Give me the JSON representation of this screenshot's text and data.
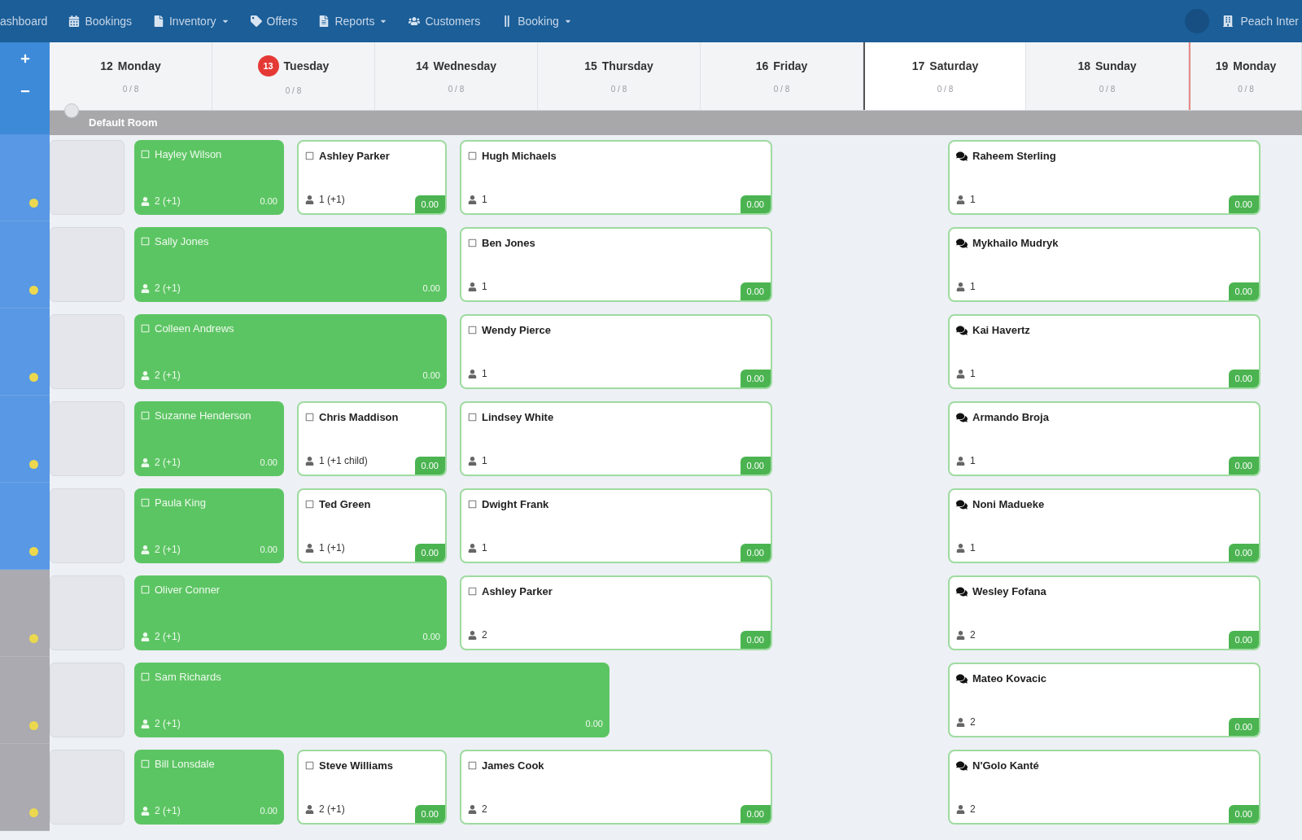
{
  "nav": {
    "items": [
      {
        "label": "ashboard",
        "dropdown": false
      },
      {
        "label": "Bookings",
        "dropdown": false
      },
      {
        "label": "Inventory",
        "dropdown": true
      },
      {
        "label": "Offers",
        "dropdown": false
      },
      {
        "label": "Reports",
        "dropdown": true
      },
      {
        "label": "Customers",
        "dropdown": false
      },
      {
        "label": "Booking",
        "dropdown": true
      }
    ],
    "account": "Peach Inter"
  },
  "days": [
    {
      "number": "12",
      "name": "Monday",
      "sub": "0 / 8",
      "today": false,
      "highlighted": false,
      "week_start": false
    },
    {
      "number": "13",
      "name": "Tuesday",
      "sub": "0 / 8",
      "today": true,
      "highlighted": false,
      "week_start": false
    },
    {
      "number": "14",
      "name": "Wednesday",
      "sub": "0 / 8",
      "today": false,
      "highlighted": false,
      "week_start": false
    },
    {
      "number": "15",
      "name": "Thursday",
      "sub": "0 / 8",
      "today": false,
      "highlighted": false,
      "week_start": false
    },
    {
      "number": "16",
      "name": "Friday",
      "sub": "0 / 8",
      "today": false,
      "highlighted": false,
      "week_start": false
    },
    {
      "number": "17",
      "name": "Saturday",
      "sub": "0 / 8",
      "today": false,
      "highlighted": true,
      "week_start": false
    },
    {
      "number": "18",
      "name": "Sunday",
      "sub": "0 / 8",
      "today": false,
      "highlighted": false,
      "week_start": false
    },
    {
      "number": "19",
      "name": "Monday",
      "sub": "0 / 8",
      "today": false,
      "highlighted": false,
      "week_start": true
    }
  ],
  "group": {
    "label": "Default Room"
  },
  "rows": [
    {
      "color": "#5898e4",
      "weekday_bookings": [
        {
          "kind": "short",
          "confirmed": true,
          "message": false,
          "name": "Hayley Wilson",
          "guests": "2 (+1)",
          "amount": "0.00"
        },
        {
          "kind": "short",
          "confirmed": false,
          "message": false,
          "name": "Ashley Parker",
          "guests": "1 (+1)",
          "amount": "0.00"
        },
        {
          "kind": "long",
          "confirmed": false,
          "message": false,
          "name": "Hugh Michaels",
          "guests": "1",
          "amount": "0.00"
        }
      ],
      "weekend_booking": {
        "kind": "long",
        "confirmed": false,
        "message": true,
        "name": "Raheem Sterling",
        "guests": "1",
        "amount": "0.00"
      }
    },
    {
      "color": "#5898e4",
      "weekday_bookings": [
        {
          "kind": "long",
          "confirmed": true,
          "message": false,
          "name": "Sally Jones",
          "guests": "2 (+1)",
          "amount": "0.00"
        },
        {
          "kind": "long",
          "confirmed": false,
          "message": false,
          "name": "Ben Jones",
          "guests": "1",
          "amount": "0.00"
        }
      ],
      "weekend_booking": {
        "kind": "long",
        "confirmed": false,
        "message": true,
        "name": "Mykhailo Mudryk",
        "guests": "1",
        "amount": "0.00"
      }
    },
    {
      "color": "#5898e4",
      "weekday_bookings": [
        {
          "kind": "long",
          "confirmed": true,
          "message": false,
          "name": "Colleen Andrews",
          "guests": "2 (+1)",
          "amount": "0.00"
        },
        {
          "kind": "long",
          "confirmed": false,
          "message": false,
          "name": "Wendy Pierce",
          "guests": "1",
          "amount": "0.00"
        }
      ],
      "weekend_booking": {
        "kind": "long",
        "confirmed": false,
        "message": true,
        "name": "Kai Havertz",
        "guests": "1",
        "amount": "0.00"
      }
    },
    {
      "color": "#5898e4",
      "weekday_bookings": [
        {
          "kind": "short",
          "confirmed": true,
          "message": false,
          "name": "Suzanne Henderson",
          "guests": "2 (+1)",
          "amount": "0.00"
        },
        {
          "kind": "short",
          "confirmed": false,
          "message": false,
          "name": "Chris Maddison",
          "guests": "1 (+1 child)",
          "amount": "0.00"
        },
        {
          "kind": "long",
          "confirmed": false,
          "message": false,
          "name": "Lindsey White",
          "guests": "1",
          "amount": "0.00"
        }
      ],
      "weekend_booking": {
        "kind": "long",
        "confirmed": false,
        "message": true,
        "name": "Armando Broja",
        "guests": "1",
        "amount": "0.00"
      }
    },
    {
      "color": "#5898e4",
      "weekday_bookings": [
        {
          "kind": "short",
          "confirmed": true,
          "message": false,
          "name": "Paula King",
          "guests": "2 (+1)",
          "amount": "0.00"
        },
        {
          "kind": "short",
          "confirmed": false,
          "message": false,
          "name": "Ted Green",
          "guests": "1 (+1)",
          "amount": "0.00"
        },
        {
          "kind": "long",
          "confirmed": false,
          "message": false,
          "name": "Dwight Frank",
          "guests": "1",
          "amount": "0.00"
        }
      ],
      "weekend_booking": {
        "kind": "long",
        "confirmed": false,
        "message": true,
        "name": "Noni Madueke",
        "guests": "1",
        "amount": "0.00"
      }
    },
    {
      "color": "#aaaab0",
      "weekday_bookings": [
        {
          "kind": "long",
          "confirmed": true,
          "message": false,
          "name": "Oliver Conner",
          "guests": "2 (+1)",
          "amount": "0.00"
        },
        {
          "kind": "long",
          "confirmed": false,
          "message": false,
          "name": "Ashley Parker",
          "guests": "2",
          "amount": "0.00"
        }
      ],
      "weekend_booking": {
        "kind": "long",
        "confirmed": false,
        "message": true,
        "name": "Wesley Fofana",
        "guests": "2",
        "amount": "0.00"
      }
    },
    {
      "color": "#aaaab0",
      "weekday_bookings": [
        {
          "kind": "extended",
          "confirmed": true,
          "message": false,
          "name": "Sam Richards",
          "guests": "2 (+1)",
          "amount": "0.00"
        }
      ],
      "weekend_booking": {
        "kind": "long",
        "confirmed": false,
        "message": true,
        "name": "Mateo Kovacic",
        "guests": "2",
        "amount": "0.00"
      }
    },
    {
      "color": "#aaaab0",
      "weekday_bookings": [
        {
          "kind": "short",
          "confirmed": true,
          "message": false,
          "name": "Bill Lonsdale",
          "guests": "2 (+1)",
          "amount": "0.00"
        },
        {
          "kind": "short",
          "confirmed": false,
          "message": false,
          "name": "Steve Williams",
          "guests": "2 (+1)",
          "amount": "0.00"
        },
        {
          "kind": "long",
          "confirmed": false,
          "message": false,
          "name": "James Cook",
          "guests": "2",
          "amount": "0.00"
        }
      ],
      "weekend_booking": {
        "kind": "long",
        "confirmed": false,
        "message": true,
        "name": "N'Golo Kanté",
        "guests": "2",
        "amount": "0.00"
      }
    }
  ]
}
